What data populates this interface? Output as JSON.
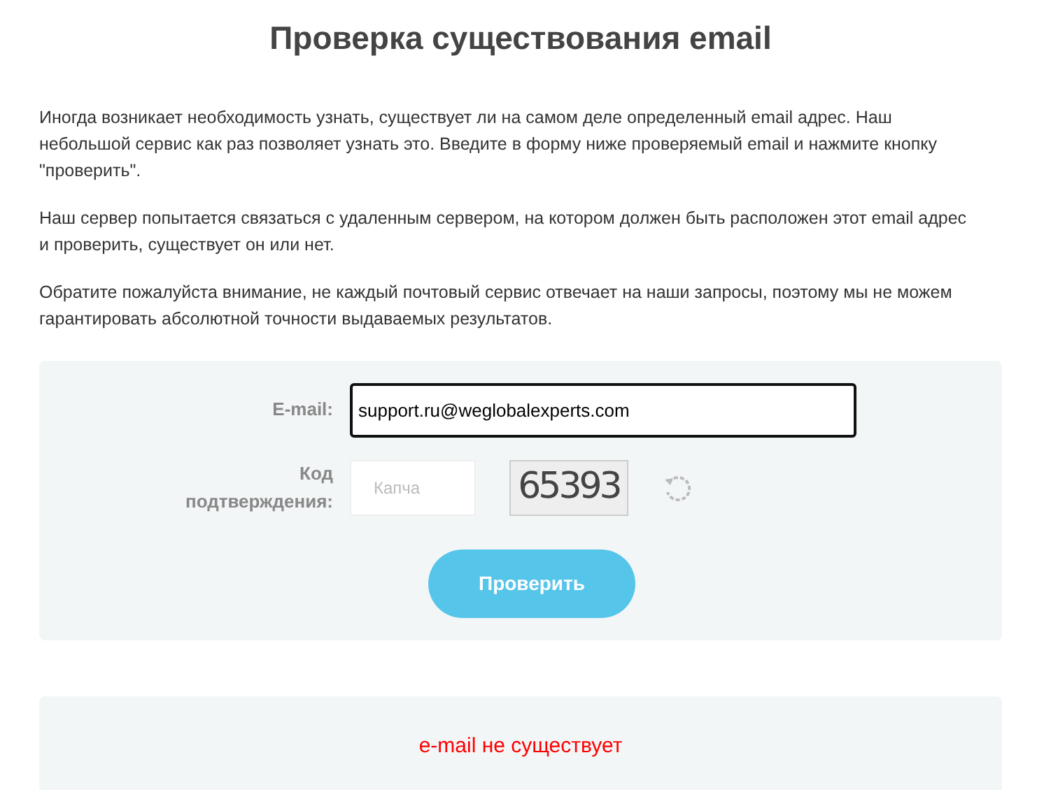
{
  "title": "Проверка существования email",
  "paragraphs": [
    "Иногда возникает необходимость узнать, существует ли на самом деле определенный email адрес. Наш небольшой сервис как раз позволяет узнать это. Введите в форму ниже проверяемый email и нажмите кнопку \"проверить\".",
    "Наш сервер попытается связаться с удаленным сервером, на котором должен быть расположен этот email адрес и проверить, существует он или нет.",
    "Обратите пожалуйста внимание, не каждый почтовый сервис отвечает на наши запросы, поэтому мы не можем гарантировать абсолютной точности выдаваемых результатов."
  ],
  "form": {
    "email_label": "E-mail:",
    "email_value": "support.ru@weglobalexperts.com",
    "email_focused": true,
    "captcha_label": "Код подтверждения:",
    "captcha_placeholder": "Капча",
    "captcha_image_text": "65393",
    "submit": "Проверить"
  },
  "result": {
    "text": "e-mail не существует",
    "is_error": true
  }
}
